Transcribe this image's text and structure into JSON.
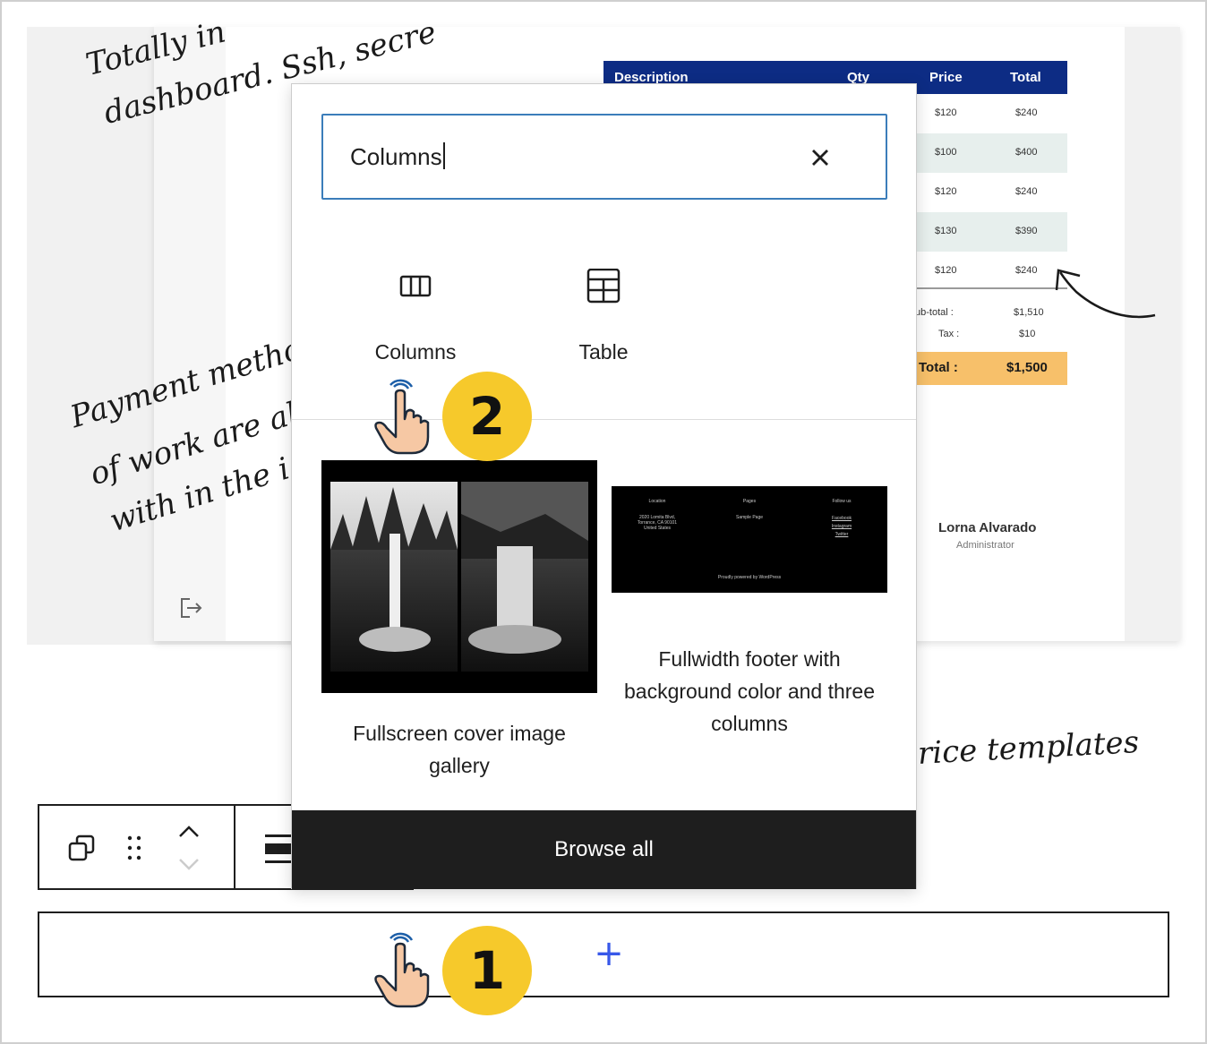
{
  "background": {
    "script_lines": [
      "Totally in",
      "dashboard. Ssh, secre",
      "Payment metho",
      "of work are al",
      "with in the i",
      "rice templates"
    ],
    "invoice": {
      "headers": [
        "Description",
        "Qty",
        "Price",
        "Total"
      ],
      "rows": [
        {
          "price": "$120",
          "total": "$240"
        },
        {
          "price": "$100",
          "total": "$400"
        },
        {
          "price": "$120",
          "total": "$240"
        },
        {
          "price": "$130",
          "total": "$390"
        },
        {
          "price": "$120",
          "total": "$240"
        }
      ],
      "subtotal_label": "ub-total :",
      "subtotal_value": "$1,510",
      "tax_label": "Tax :",
      "tax_value": "$10",
      "total_label": "Total :",
      "total_value": "$1,500"
    },
    "author_name": "Lorna Alvarado",
    "author_role": "Administrator"
  },
  "inserter": {
    "search_value": "Columns",
    "blocks": [
      {
        "label": "Columns",
        "icon": "columns-icon"
      },
      {
        "label": "Table",
        "icon": "table-icon"
      }
    ],
    "patterns": [
      {
        "label": "Fullscreen cover image gallery"
      },
      {
        "label": "Fullwidth footer with background color and three columns",
        "footer": {
          "col1_title": "Location",
          "col1_lines": [
            "2020 Lomita Blvd,",
            "Torrance, CA 90101",
            "United States"
          ],
          "col2_title": "Pages",
          "col2_lines": [
            "Sample Page"
          ],
          "col3_title": "Follow us",
          "col3_lines": [
            "Facebook",
            "Instagram",
            "Twitter"
          ],
          "credit": "Proudly powered by WordPress"
        }
      }
    ],
    "browse_all_label": "Browse all"
  },
  "toolbar": {
    "icons": [
      "duplicate-icon",
      "drag-handle-icon",
      "move-up-icon",
      "move-down-icon",
      "align-icon"
    ]
  },
  "appender": {
    "plus": "+"
  },
  "steps": [
    {
      "number": "1"
    },
    {
      "number": "2"
    }
  ],
  "colors": {
    "accent": "#3858e9",
    "search_border": "#3b7dba",
    "badge": "#f6c92b",
    "browse_bg": "#1e1e1e",
    "invoice_header": "#0d2c84",
    "invoice_total": "#f7c06a"
  }
}
